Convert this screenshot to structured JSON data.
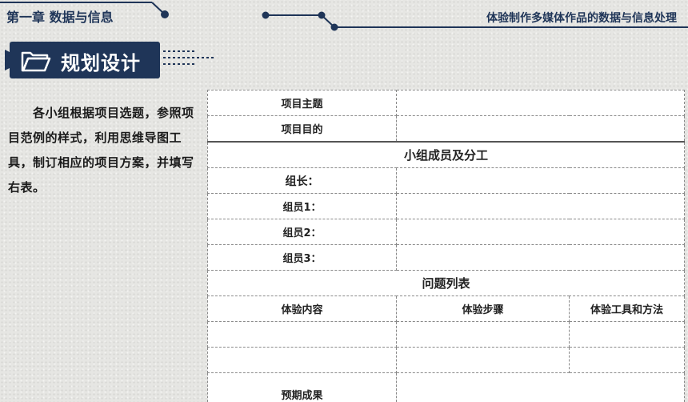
{
  "header": {
    "chapter": "第一章 数据与信息",
    "lesson": "体验制作多媒体作品的数据与信息处理"
  },
  "banner": {
    "title": "规划设计",
    "icon": "folder-icon"
  },
  "intro": {
    "text": "各小组根据项目选题，参照项目范例的样式，利用思维导图工具，制订相应的项目方案，并填写右表。"
  },
  "form": {
    "rows": {
      "theme_label": "项目主题",
      "purpose_label": "项目目的",
      "members_heading": "小组成员及分工",
      "leader_label": "组长：",
      "member1_label": "组员1：",
      "member2_label": "组员2：",
      "member3_label": "组员3：",
      "issues_heading": "问题列表",
      "col_content": "体验内容",
      "col_steps": "体验步骤",
      "col_tools": "体验工具和方法",
      "expected_label": "预期成果"
    }
  },
  "colors": {
    "navy": "#1f3558",
    "background": "#e6e6e3"
  }
}
